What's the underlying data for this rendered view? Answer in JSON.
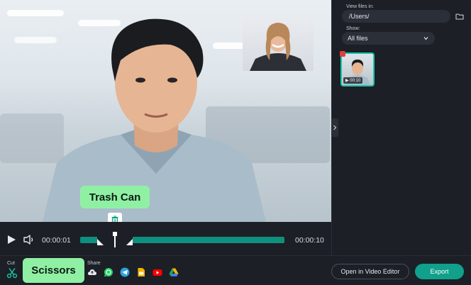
{
  "player": {
    "current_time": "00:00:01",
    "total_time": "00:00:10"
  },
  "tooltips": {
    "trash": "Trash Can",
    "scissors": "Scissors"
  },
  "bottombar": {
    "cut_label": "Cut",
    "share_label": "Share",
    "open_editor": "Open in Video Editor",
    "export": "Export",
    "share_targets": [
      {
        "icon": "cloud-upload-icon",
        "color": "#e6e8ee"
      },
      {
        "icon": "whatsapp-icon",
        "color": "#25d366"
      },
      {
        "icon": "telegram-icon",
        "color": "#2aa3df"
      },
      {
        "icon": "google-slides-icon",
        "color": "#f4b400"
      },
      {
        "icon": "youtube-icon",
        "color": "#ff0000"
      },
      {
        "icon": "google-drive-icon",
        "color": "#1fa463"
      }
    ]
  },
  "panel": {
    "view_label": "View files in:",
    "path": "/Users/",
    "show_label": "Show:",
    "show_value": "All files",
    "thumbnail_duration": "00:10"
  },
  "colors": {
    "accent": "#10a08b",
    "tooltip": "#8ff0a4",
    "track": "#0f8f7d"
  }
}
